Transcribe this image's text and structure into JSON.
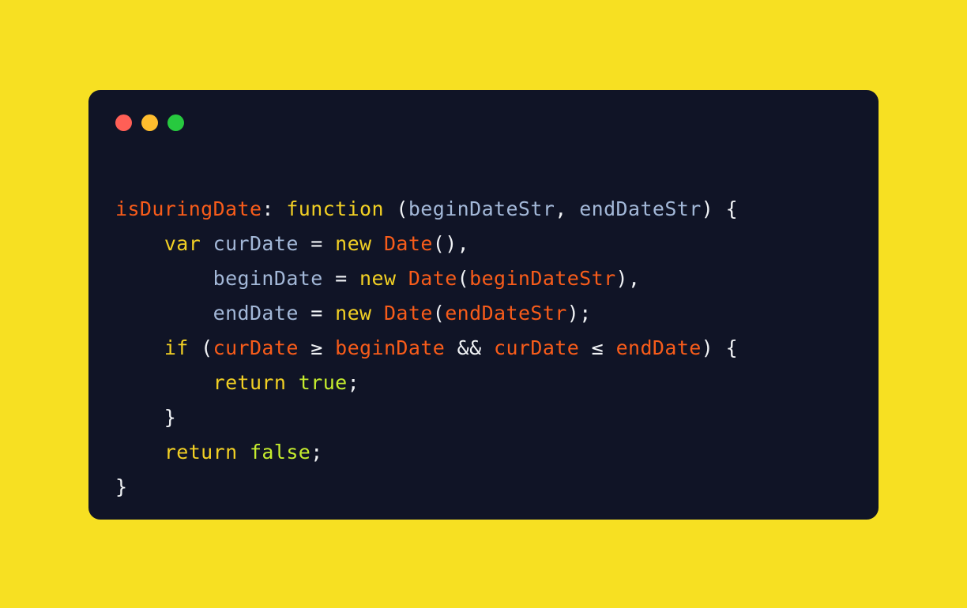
{
  "page": {
    "background_color": "#F7E022",
    "card_background_color": "#101426"
  },
  "window": {
    "traffic_lights": [
      {
        "name": "close",
        "color": "#FF5F56"
      },
      {
        "name": "minimize",
        "color": "#FFBD2E"
      },
      {
        "name": "maximize",
        "color": "#27C93F"
      }
    ]
  },
  "palette": {
    "property": "#F85C1A",
    "keyword": "#F2D024",
    "parameter": "#A3B8D8",
    "variable": "#A3B8D8",
    "identifier": "#F85C1A",
    "boolean": "#C6ED2E",
    "punctuation": "#F0F2F5"
  },
  "code": {
    "language": "javascript",
    "plain_text": "isDuringDate: function (beginDateStr, endDateStr) {\n    var curDate = new Date(),\n        beginDate = new Date(beginDateStr),\n        endDate = new Date(endDateStr);\n    if (curDate >= beginDate && curDate <= endDate) {\n        return true;\n    }\n    return false;\n}",
    "lines": [
      {
        "tokens": [
          {
            "t": "isDuringDate",
            "c": "prop"
          },
          {
            "t": ": ",
            "c": "punct"
          },
          {
            "t": "function",
            "c": "kw"
          },
          {
            "t": " (",
            "c": "punct"
          },
          {
            "t": "beginDateStr",
            "c": "param"
          },
          {
            "t": ", ",
            "c": "punct"
          },
          {
            "t": "endDateStr",
            "c": "param"
          },
          {
            "t": ") {",
            "c": "punct"
          }
        ]
      },
      {
        "tokens": [
          {
            "t": "    ",
            "c": "punct"
          },
          {
            "t": "var",
            "c": "kw"
          },
          {
            "t": " ",
            "c": "punct"
          },
          {
            "t": "curDate",
            "c": "var"
          },
          {
            "t": " ",
            "c": "punct"
          },
          {
            "t": "=",
            "c": "op"
          },
          {
            "t": " ",
            "c": "punct"
          },
          {
            "t": "new",
            "c": "kw"
          },
          {
            "t": " ",
            "c": "punct"
          },
          {
            "t": "Date",
            "c": "class"
          },
          {
            "t": "(),",
            "c": "punct"
          }
        ]
      },
      {
        "tokens": [
          {
            "t": "        ",
            "c": "punct"
          },
          {
            "t": "beginDate",
            "c": "var"
          },
          {
            "t": " ",
            "c": "punct"
          },
          {
            "t": "=",
            "c": "op"
          },
          {
            "t": " ",
            "c": "punct"
          },
          {
            "t": "new",
            "c": "kw"
          },
          {
            "t": " ",
            "c": "punct"
          },
          {
            "t": "Date",
            "c": "class"
          },
          {
            "t": "(",
            "c": "punct"
          },
          {
            "t": "beginDateStr",
            "c": "ident"
          },
          {
            "t": "),",
            "c": "punct"
          }
        ]
      },
      {
        "tokens": [
          {
            "t": "        ",
            "c": "punct"
          },
          {
            "t": "endDate",
            "c": "var"
          },
          {
            "t": " ",
            "c": "punct"
          },
          {
            "t": "=",
            "c": "op"
          },
          {
            "t": " ",
            "c": "punct"
          },
          {
            "t": "new",
            "c": "kw"
          },
          {
            "t": " ",
            "c": "punct"
          },
          {
            "t": "Date",
            "c": "class"
          },
          {
            "t": "(",
            "c": "punct"
          },
          {
            "t": "endDateStr",
            "c": "ident"
          },
          {
            "t": ");",
            "c": "punct"
          }
        ]
      },
      {
        "tokens": [
          {
            "t": "    ",
            "c": "punct"
          },
          {
            "t": "if",
            "c": "kw"
          },
          {
            "t": " (",
            "c": "punct"
          },
          {
            "t": "curDate",
            "c": "ident"
          },
          {
            "t": " ",
            "c": "punct"
          },
          {
            "t": "≥",
            "c": "op"
          },
          {
            "t": " ",
            "c": "punct"
          },
          {
            "t": "beginDate",
            "c": "ident"
          },
          {
            "t": " ",
            "c": "punct"
          },
          {
            "t": "&&",
            "c": "op"
          },
          {
            "t": " ",
            "c": "punct"
          },
          {
            "t": "curDate",
            "c": "ident"
          },
          {
            "t": " ",
            "c": "punct"
          },
          {
            "t": "≤",
            "c": "op"
          },
          {
            "t": " ",
            "c": "punct"
          },
          {
            "t": "endDate",
            "c": "ident"
          },
          {
            "t": ") {",
            "c": "punct"
          }
        ]
      },
      {
        "tokens": [
          {
            "t": "        ",
            "c": "punct"
          },
          {
            "t": "return",
            "c": "kw"
          },
          {
            "t": " ",
            "c": "punct"
          },
          {
            "t": "true",
            "c": "bool"
          },
          {
            "t": ";",
            "c": "punct"
          }
        ]
      },
      {
        "tokens": [
          {
            "t": "    }",
            "c": "punct"
          }
        ]
      },
      {
        "tokens": [
          {
            "t": "    ",
            "c": "punct"
          },
          {
            "t": "return",
            "c": "kw"
          },
          {
            "t": " ",
            "c": "punct"
          },
          {
            "t": "false",
            "c": "bool"
          },
          {
            "t": ";",
            "c": "punct"
          }
        ]
      },
      {
        "tokens": [
          {
            "t": "}",
            "c": "punct"
          }
        ]
      }
    ]
  }
}
